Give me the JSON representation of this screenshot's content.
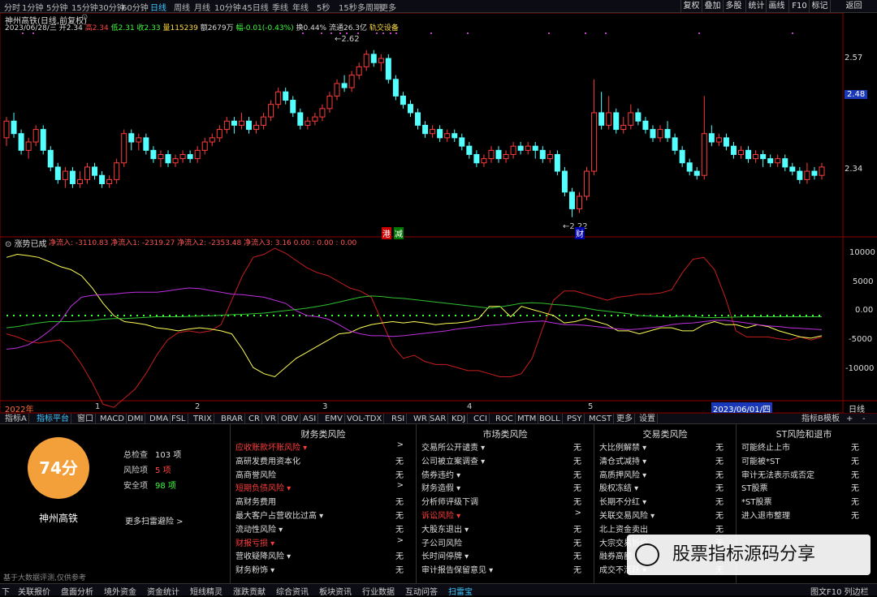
{
  "top_bar": {
    "periods": [
      "分时",
      "1分钟",
      "5分钟",
      "15分钟",
      "30分钟",
      "60分钟",
      "日线",
      "周线",
      "月线",
      "10分钟",
      "45日线",
      "季线",
      "年线",
      "5秒",
      "15秒",
      "多周期",
      "更多"
    ],
    "active": "日线",
    "right_buttons": [
      "复权",
      "叠加",
      "多股",
      "统计",
      "画线",
      "F10",
      "标记",
      "返回"
    ]
  },
  "stock": {
    "title": "神州高铁(日线,前复权)",
    "date_line": "2023/06/28/三",
    "open": "开2.34",
    "high": "高2.34",
    "low": "低2.31",
    "close": "收2.33",
    "volume": "量115239",
    "amount": "额2679万",
    "change": "幅-0.01(-0.43%)",
    "turnover": "换0.44%",
    "float": "流通26.3亿",
    "sector": "轨交设备",
    "name": "神州高铁"
  },
  "price_chart": {
    "price_labels": [
      "2.57",
      "2.48",
      "2.34"
    ],
    "highlight_price": "2.48",
    "peak_label": "2.62",
    "trough_label": "2.22",
    "markers": [
      "港",
      "减",
      "财"
    ],
    "candles": [
      [
        2.41,
        2.45,
        2.46,
        2.39
      ],
      [
        2.45,
        2.42,
        2.47,
        2.41
      ],
      [
        2.42,
        2.38,
        2.43,
        2.37
      ],
      [
        2.38,
        2.4,
        2.41,
        2.36
      ],
      [
        2.4,
        2.43,
        2.44,
        2.39
      ],
      [
        2.43,
        2.38,
        2.44,
        2.37
      ],
      [
        2.38,
        2.34,
        2.39,
        2.33
      ],
      [
        2.34,
        2.31,
        2.35,
        2.3
      ],
      [
        2.31,
        2.33,
        2.34,
        2.29
      ],
      [
        2.33,
        2.3,
        2.34,
        2.29
      ],
      [
        2.3,
        2.31,
        2.33,
        2.29
      ],
      [
        2.31,
        2.34,
        2.35,
        2.3
      ],
      [
        2.34,
        2.32,
        2.35,
        2.31
      ],
      [
        2.32,
        2.3,
        2.33,
        2.29
      ],
      [
        2.3,
        2.31,
        2.32,
        2.29
      ],
      [
        2.31,
        2.35,
        2.36,
        2.3
      ],
      [
        2.35,
        2.42,
        2.43,
        2.34
      ],
      [
        2.42,
        2.4,
        2.43,
        2.38
      ],
      [
        2.4,
        2.41,
        2.42,
        2.38
      ],
      [
        2.41,
        2.38,
        2.42,
        2.37
      ],
      [
        2.38,
        2.36,
        2.39,
        2.35
      ],
      [
        2.36,
        2.37,
        2.38,
        2.34
      ],
      [
        2.37,
        2.35,
        2.38,
        2.34
      ],
      [
        2.35,
        2.36,
        2.37,
        2.34
      ],
      [
        2.36,
        2.37,
        2.38,
        2.35
      ],
      [
        2.37,
        2.36,
        2.38,
        2.35
      ],
      [
        2.36,
        2.38,
        2.39,
        2.35
      ],
      [
        2.38,
        2.4,
        2.41,
        2.37
      ],
      [
        2.4,
        2.41,
        2.42,
        2.39
      ],
      [
        2.41,
        2.43,
        2.44,
        2.4
      ],
      [
        2.43,
        2.45,
        2.46,
        2.42
      ],
      [
        2.45,
        2.44,
        2.46,
        2.42
      ],
      [
        2.44,
        2.45,
        2.47,
        2.43
      ],
      [
        2.45,
        2.43,
        2.46,
        2.42
      ],
      [
        2.43,
        2.44,
        2.45,
        2.42
      ],
      [
        2.44,
        2.46,
        2.47,
        2.43
      ],
      [
        2.46,
        2.49,
        2.5,
        2.45
      ],
      [
        2.49,
        2.52,
        2.53,
        2.48
      ],
      [
        2.52,
        2.5,
        2.53,
        2.49
      ],
      [
        2.5,
        2.47,
        2.51,
        2.46
      ],
      [
        2.47,
        2.44,
        2.48,
        2.43
      ],
      [
        2.44,
        2.45,
        2.46,
        2.43
      ],
      [
        2.45,
        2.46,
        2.47,
        2.44
      ],
      [
        2.46,
        2.48,
        2.49,
        2.45
      ],
      [
        2.48,
        2.51,
        2.52,
        2.47
      ],
      [
        2.51,
        2.54,
        2.55,
        2.5
      ],
      [
        2.54,
        2.53,
        2.56,
        2.52
      ],
      [
        2.53,
        2.56,
        2.57,
        2.52
      ],
      [
        2.56,
        2.58,
        2.59,
        2.55
      ],
      [
        2.58,
        2.61,
        2.62,
        2.57
      ],
      [
        2.61,
        2.59,
        2.62,
        2.58
      ],
      [
        2.59,
        2.6,
        2.61,
        2.57
      ],
      [
        2.6,
        2.55,
        2.61,
        2.54
      ],
      [
        2.55,
        2.51,
        2.56,
        2.5
      ],
      [
        2.51,
        2.49,
        2.52,
        2.48
      ],
      [
        2.49,
        2.47,
        2.5,
        2.46
      ],
      [
        2.47,
        2.44,
        2.48,
        2.43
      ],
      [
        2.44,
        2.42,
        2.45,
        2.41
      ],
      [
        2.42,
        2.43,
        2.44,
        2.41
      ],
      [
        2.43,
        2.41,
        2.44,
        2.4
      ],
      [
        2.41,
        2.42,
        2.43,
        2.4
      ],
      [
        2.42,
        2.41,
        2.43,
        2.4
      ],
      [
        2.41,
        2.39,
        2.42,
        2.38
      ],
      [
        2.39,
        2.37,
        2.4,
        2.36
      ],
      [
        2.37,
        2.35,
        2.38,
        2.34
      ],
      [
        2.35,
        2.36,
        2.37,
        2.34
      ],
      [
        2.36,
        2.38,
        2.39,
        2.35
      ],
      [
        2.38,
        2.36,
        2.39,
        2.35
      ],
      [
        2.36,
        2.37,
        2.38,
        2.35
      ],
      [
        2.37,
        2.39,
        2.4,
        2.36
      ],
      [
        2.39,
        2.38,
        2.4,
        2.37
      ],
      [
        2.38,
        2.39,
        2.4,
        2.37
      ],
      [
        2.39,
        2.38,
        2.4,
        2.36
      ],
      [
        2.38,
        2.36,
        2.39,
        2.35
      ],
      [
        2.36,
        2.37,
        2.38,
        2.35
      ],
      [
        2.37,
        2.33,
        2.38,
        2.32
      ],
      [
        2.33,
        2.28,
        2.34,
        2.27
      ],
      [
        2.28,
        2.24,
        2.29,
        2.22
      ],
      [
        2.24,
        2.27,
        2.28,
        2.23
      ],
      [
        2.27,
        2.33,
        2.34,
        2.26
      ],
      [
        2.33,
        2.47,
        2.55,
        2.32
      ],
      [
        2.47,
        2.44,
        2.52,
        2.43
      ],
      [
        2.44,
        2.47,
        2.51,
        2.43
      ],
      [
        2.47,
        2.43,
        2.48,
        2.42
      ],
      [
        2.43,
        2.44,
        2.46,
        2.42
      ],
      [
        2.44,
        2.47,
        2.49,
        2.43
      ],
      [
        2.47,
        2.45,
        2.48,
        2.44
      ],
      [
        2.45,
        2.43,
        2.46,
        2.42
      ],
      [
        2.43,
        2.41,
        2.44,
        2.4
      ],
      [
        2.41,
        2.43,
        2.44,
        2.4
      ],
      [
        2.43,
        2.41,
        2.45,
        2.4
      ],
      [
        2.41,
        2.38,
        2.42,
        2.37
      ],
      [
        2.38,
        2.35,
        2.39,
        2.34
      ],
      [
        2.35,
        2.33,
        2.36,
        2.32
      ],
      [
        2.33,
        2.32,
        2.34,
        2.31
      ],
      [
        2.32,
        2.42,
        2.51,
        2.31
      ],
      [
        2.42,
        2.4,
        2.44,
        2.39
      ],
      [
        2.4,
        2.41,
        2.42,
        2.39
      ],
      [
        2.41,
        2.39,
        2.42,
        2.38
      ],
      [
        2.39,
        2.37,
        2.4,
        2.36
      ],
      [
        2.37,
        2.38,
        2.39,
        2.36
      ],
      [
        2.38,
        2.36,
        2.39,
        2.35
      ],
      [
        2.36,
        2.37,
        2.38,
        2.35
      ],
      [
        2.37,
        2.36,
        2.38,
        2.34
      ],
      [
        2.36,
        2.35,
        2.37,
        2.34
      ],
      [
        2.35,
        2.36,
        2.37,
        2.34
      ],
      [
        2.36,
        2.34,
        2.37,
        2.33
      ],
      [
        2.34,
        2.33,
        2.35,
        2.32
      ],
      [
        2.33,
        2.31,
        2.34,
        2.3
      ],
      [
        2.31,
        2.33,
        2.35,
        2.3
      ],
      [
        2.33,
        2.32,
        2.34,
        2.31
      ],
      [
        2.32,
        2.34,
        2.35,
        2.31
      ]
    ]
  },
  "indicator": {
    "name": "涨势已成",
    "values_line": "净流入: -3110.83  净流入1: -2319.27  净流入2: -2353.48  净流入3: 3.16  0.00 : 0.00 : 0.00",
    "axis_labels": [
      "10000",
      "5000",
      "0.00",
      "-5000",
      "-10000"
    ],
    "series": {
      "red": [
        -3000,
        -3500,
        -4200,
        -4500,
        -4200,
        -4000,
        -5500,
        -8000,
        -11000,
        -14500,
        -15000,
        -13500,
        -12000,
        -9500,
        -6500,
        -4000,
        -2800,
        -2500,
        -2800,
        -2500,
        -1500,
        2500,
        6500,
        9500,
        10000,
        11000,
        10200,
        9000,
        7800,
        7000,
        6500,
        5500,
        4500,
        4000,
        3000,
        -1000,
        -5000,
        -7000,
        -6500,
        -7500,
        -8000,
        -8000,
        -8500,
        -9000,
        -9000,
        -9500,
        -10000,
        -10000,
        -9500,
        -7000,
        -2000,
        2500,
        4000,
        4000,
        3500,
        3000,
        2500,
        3000,
        3200,
        3500,
        3500,
        3700,
        4200,
        7000,
        9200,
        9500,
        7500,
        3000,
        -2500,
        -3500,
        -3500,
        -3500,
        -3800,
        -4000,
        -3500,
        -4000,
        -3500
      ],
      "yellow": [
        9500,
        10000,
        9800,
        9500,
        8800,
        8000,
        7500,
        6500,
        4500,
        2000,
        0,
        -1000,
        -1200,
        -1500,
        -2000,
        -2200,
        -2500,
        -2200,
        -2000,
        -2200,
        -2500,
        -3000,
        -5500,
        -8500,
        -9500,
        -10000,
        -8500,
        -7000,
        -6000,
        -5000,
        -4000,
        -3000,
        -2800,
        -2000,
        -1500,
        -1200,
        -1000,
        -1200,
        -1000,
        -1200,
        -1500,
        -1300,
        -1200,
        -1000,
        -500,
        1500,
        1500,
        -200,
        1500,
        1000,
        500,
        0,
        -1200,
        -1000,
        -500,
        -1000,
        -1500,
        -2500,
        -2500,
        -3000,
        -2500,
        -2000,
        -2000,
        -2500,
        -2500,
        -1500,
        -1000,
        -1500,
        -1500,
        -2000,
        -1500,
        -1800,
        -2500,
        -3000,
        -3500,
        -3700,
        -3300
      ],
      "magenta": [
        -5500,
        -5300,
        -4800,
        -3800,
        -2500,
        -1000,
        1500,
        3000,
        3300,
        3400,
        3500,
        3700,
        3800,
        3800,
        3800,
        4000,
        4300,
        4500,
        4400,
        4100,
        3800,
        3500,
        3400,
        3200,
        3000,
        2500,
        2000,
        800,
        0,
        -200,
        -600,
        -1500,
        -2500,
        -3000,
        -3300,
        -3300,
        -3400,
        -3300,
        -3100,
        -2900,
        -2700,
        -2500,
        -2200,
        -2000,
        -1800,
        -1600,
        -1500,
        -1300,
        -1100,
        -1000,
        -900,
        -1200,
        -1500,
        -1500,
        -1600,
        -1800,
        -2000,
        -2200,
        -2300,
        -2200,
        -2000,
        -1800,
        -1500,
        -1300,
        -1200,
        -1000,
        -800,
        -800,
        -1000,
        -1200,
        -1500,
        -1700,
        -1800,
        -2000,
        -2100,
        -2200,
        -2300
      ],
      "green": [
        -2000,
        -1800,
        -1500,
        -1200,
        -1000,
        -1000,
        -1000,
        -900,
        -800,
        -600,
        -500,
        -500,
        -400,
        -300,
        -200,
        -200,
        -200,
        -150,
        -100,
        -50,
        50,
        150,
        200,
        300,
        400,
        600,
        800,
        1000,
        1200,
        1500,
        1800,
        2200,
        2600,
        3000,
        3200,
        3100,
        2900,
        2800,
        2600,
        2400,
        2200,
        2000,
        1800,
        1600,
        1400,
        1200,
        1400,
        1700,
        2000,
        2100,
        2000,
        1800,
        1700,
        1500,
        1200,
        900,
        700,
        500,
        300,
        0,
        -100,
        -200,
        -250,
        -100,
        -200,
        -300,
        -350,
        -300,
        -250,
        -200,
        -200,
        -200,
        -200,
        -200,
        -200,
        -200,
        -200
      ]
    }
  },
  "axis": {
    "date_labels": [
      "2022年",
      "1",
      "2",
      "3",
      "4",
      "5",
      "2023/06/01/四"
    ],
    "period_label": "日线"
  },
  "tabs": [
    "指标A",
    "指标平台",
    "窗口",
    "MACD",
    "DMI",
    "DMA",
    "FSL",
    "TRIX",
    "BRAR",
    "CR",
    "VR",
    "OBV",
    "ASI",
    "EMV",
    "VOL-TDX",
    "RSI",
    "WR",
    "SAR",
    "KDJ",
    "CCI",
    "ROC",
    "MTM",
    "BOLL",
    "PSY",
    "MCST",
    "更多",
    "设置"
  ],
  "active_tab": "指标平台",
  "tabs_right": [
    "指标B",
    "模板",
    "+",
    "-"
  ],
  "risk": {
    "score": "74分",
    "name": "神州高铁",
    "total_label": "总检查",
    "total": "103 项",
    "risk_label": "风险项",
    "risk_count": "5 项",
    "safe_label": "安全项",
    "safe_count": "98 项",
    "more": "更多扫雷避险 >",
    "disclaimer": "基于大数据评测,仅供参考",
    "columns": [
      {
        "title": "财务类风险",
        "items": [
          [
            "应收账款坏账风险 ▾",
            ">",
            true
          ],
          [
            "高研发费用资本化",
            "无",
            false
          ],
          [
            "高商誉风险",
            "无",
            false
          ],
          [
            "短期负债风险 ▾",
            ">",
            true
          ],
          [
            "高财务费用",
            "无",
            false
          ],
          [
            "最大客户占营收比过高 ▾",
            "无",
            false
          ],
          [
            "流动性风险 ▾",
            "无",
            false
          ],
          [
            "财报亏损 ▾",
            ">",
            true
          ],
          [
            "营收疑降风险 ▾",
            "无",
            false
          ],
          [
            "财务粉饰 ▾",
            "无",
            false
          ]
        ]
      },
      {
        "title": "市场类风险",
        "items": [
          [
            "交易所公开谴责 ▾",
            "无",
            false
          ],
          [
            "公司被立案调查 ▾",
            "无",
            false
          ],
          [
            "债券违约 ▾",
            "无",
            false
          ],
          [
            "财务造假 ▾",
            "无",
            false
          ],
          [
            "分析师评级下调",
            "无",
            false
          ],
          [
            "诉讼风险 ▾",
            ">",
            true
          ],
          [
            "大股东退出 ▾",
            "无",
            false
          ],
          [
            "子公司风险",
            "无",
            false
          ],
          [
            "长时间停牌 ▾",
            "无",
            false
          ],
          [
            "审计报告保留意见 ▾",
            "无",
            false
          ]
        ]
      },
      {
        "title": "交易类风险",
        "items": [
          [
            "大比例解禁 ▾",
            "无",
            false
          ],
          [
            "清仓式减持 ▾",
            "无",
            false
          ],
          [
            "高质押风险 ▾",
            "无",
            false
          ],
          [
            "股权冻结 ▾",
            "无",
            false
          ],
          [
            "长期不分红 ▾",
            "无",
            false
          ],
          [
            "关联交易风险 ▾",
            "无",
            false
          ],
          [
            "北上资金卖出",
            "无",
            false
          ],
          [
            "大宗交易折价",
            "无",
            false
          ],
          [
            "融券高额",
            "无",
            false
          ],
          [
            "成交不活跃 ▾",
            "无",
            false
          ]
        ]
      },
      {
        "title": "ST风险和退市",
        "items": [
          [
            "可能终止上市",
            "无",
            false
          ],
          [
            "可能被*ST",
            "无",
            false
          ],
          [
            "审计无法表示或否定",
            "无",
            false
          ],
          [
            "ST股票",
            "无",
            false
          ],
          [
            "*ST股票",
            "无",
            false
          ],
          [
            "进入退市整理",
            "无",
            false
          ]
        ]
      }
    ]
  },
  "bottom_bar": {
    "items": [
      "关联报价",
      "盘面分析",
      "境外资金",
      "资金统计",
      "短线精灵",
      "涨跌贡献",
      "综合资讯",
      "板块资讯",
      "行业数据",
      "互动问答",
      "扫雷宝"
    ],
    "active": "扫雷宝",
    "right": "图文F10 列边栏",
    "left": "下"
  },
  "watermark": "股票指标源码分享"
}
